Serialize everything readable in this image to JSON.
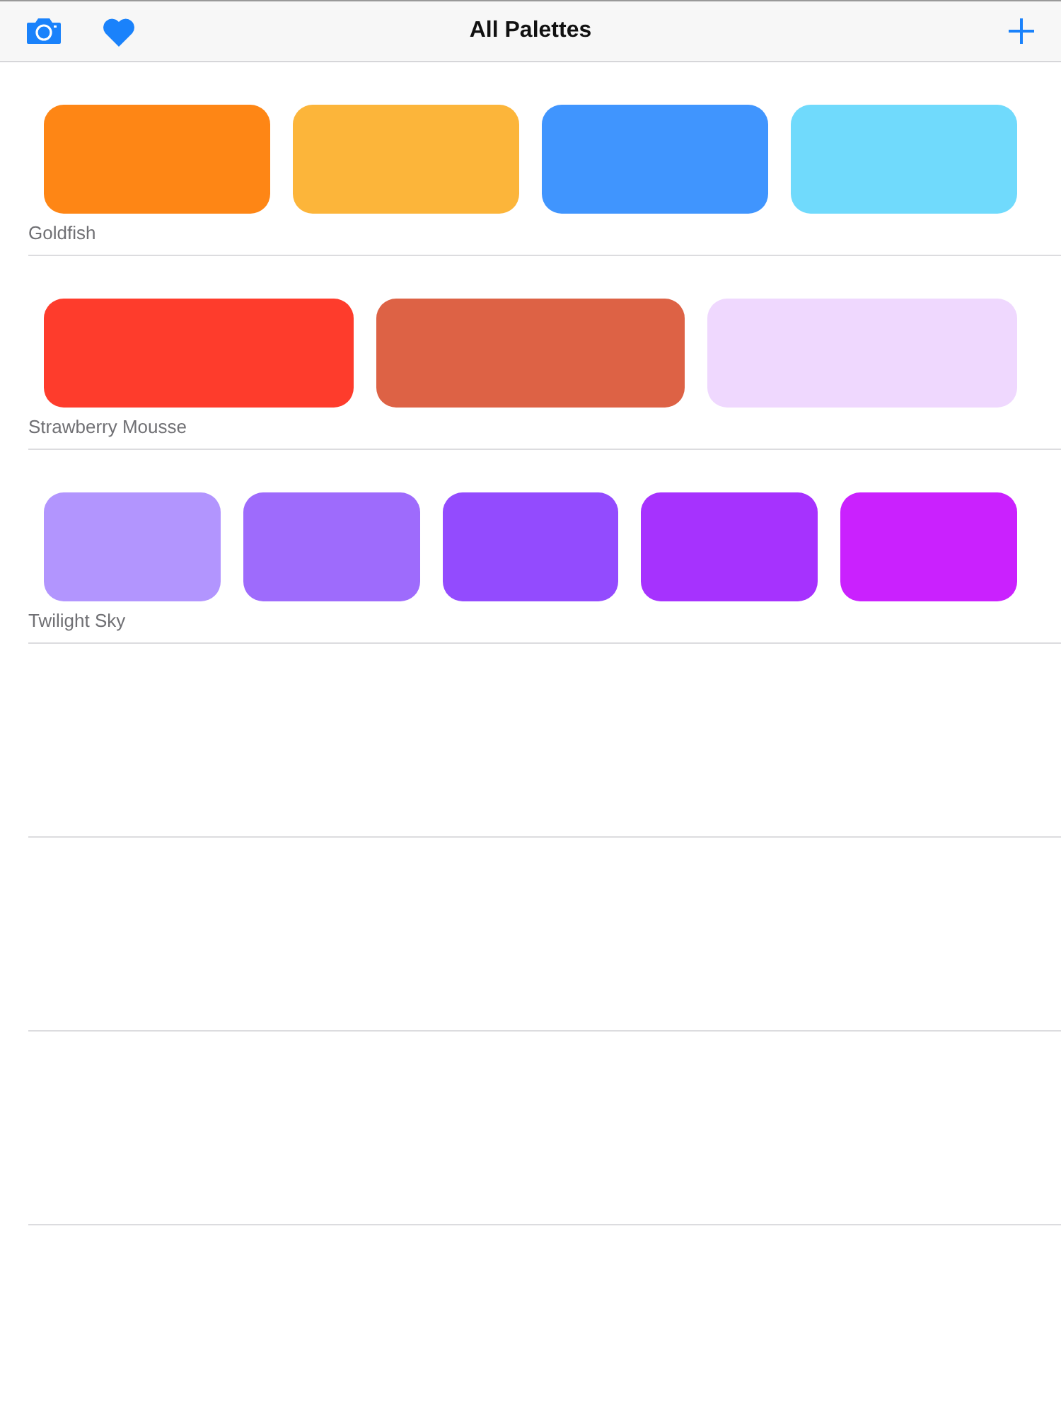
{
  "nav_bar": {
    "title": "All Palettes"
  },
  "palettes": [
    {
      "name": "Goldfish",
      "swatches": [
        {
          "color": "#fe8615"
        },
        {
          "color": "#fcb53a"
        },
        {
          "color": "#4095fe"
        },
        {
          "color": "#70dafc"
        }
      ]
    },
    {
      "name": "Strawberry Mousse",
      "swatches": [
        {
          "color": "#fe3c2c"
        },
        {
          "color": "#dd6245"
        },
        {
          "color": "#efd8fe"
        }
      ]
    },
    {
      "name": "Twilight Sky",
      "swatches": [
        {
          "color": "#b295fe"
        },
        {
          "color": "#9e6bfc"
        },
        {
          "color": "#934bfe"
        },
        {
          "color": "#a632fe"
        },
        {
          "color": "#ca21fe"
        }
      ]
    }
  ]
}
